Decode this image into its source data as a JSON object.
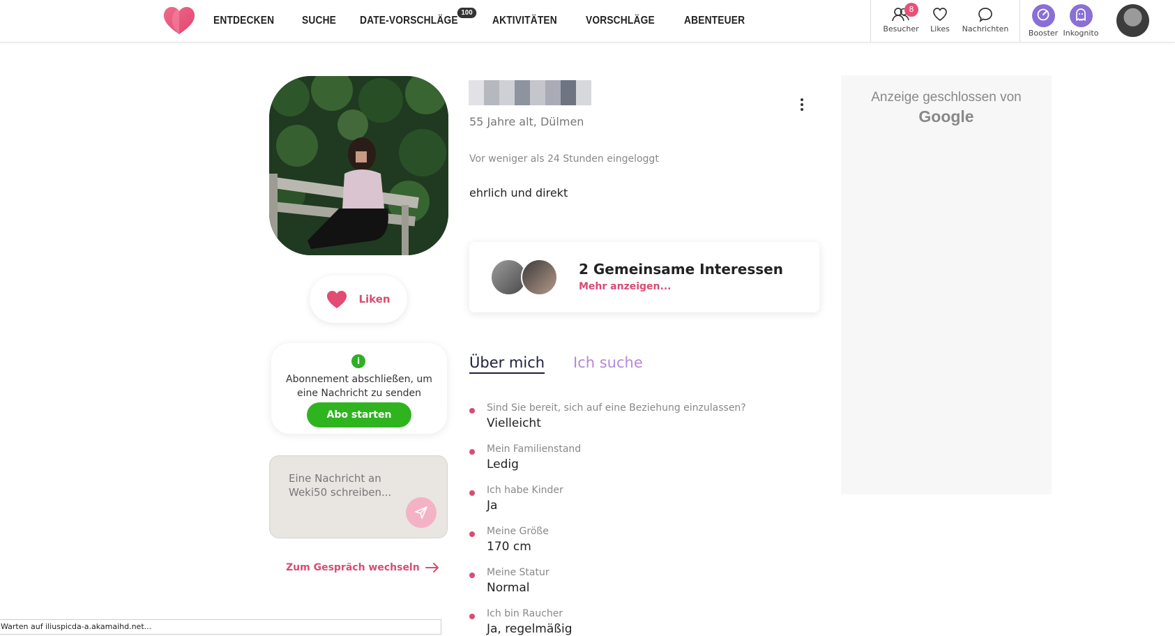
{
  "nav": {
    "items": [
      {
        "label": "ENTDECKEN"
      },
      {
        "label": "SUCHE"
      },
      {
        "label": "DATE-VORSCHLÄGE",
        "badge": "100"
      },
      {
        "label": "AKTIVITÄTEN"
      },
      {
        "label": "VORSCHLÄGE"
      },
      {
        "label": "ABENTEUER"
      }
    ]
  },
  "header_actions": {
    "visitors": {
      "label": "Besucher",
      "badge": "8",
      "icon": "visitors-icon"
    },
    "likes": {
      "label": "Likes",
      "icon": "heart-outline-icon"
    },
    "messages": {
      "label": "Nachrichten",
      "icon": "chat-bubble-icon"
    },
    "booster": {
      "label": "Booster",
      "icon": "booster-icon"
    },
    "incognito": {
      "label": "Inkognito",
      "icon": "ghost-icon"
    }
  },
  "profile": {
    "age_city": "55 Jahre alt, Dülmen",
    "last_login": "Vor weniger als 24 Stunden eingeloggt",
    "bio": "ehrlich und direkt"
  },
  "like_button": {
    "label": "Liken"
  },
  "subscription": {
    "info_glyph": "i",
    "text": "Abonnement abschließen, um eine Nachricht zu senden",
    "button": "Abo starten"
  },
  "message": {
    "placeholder": "Eine Nachricht an Weki50 schreiben..."
  },
  "switch_chat": {
    "label": "Zum Gespräch wechseln"
  },
  "interests": {
    "title": "2 Gemeinsame Interessen",
    "more": "Mehr anzeigen..."
  },
  "tabs": {
    "about": "Über mich",
    "looking": "Ich suche"
  },
  "about": [
    {
      "q": "Sind Sie bereit, sich auf eine Beziehung einzulassen?",
      "a": "Vielleicht"
    },
    {
      "q": "Mein Familienstand",
      "a": "Ledig"
    },
    {
      "q": "Ich habe Kinder",
      "a": "Ja"
    },
    {
      "q": "Meine Größe",
      "a": "170 cm"
    },
    {
      "q": "Meine Statur",
      "a": "Normal"
    },
    {
      "q": "Ich bin Raucher",
      "a": "Ja, regelmäßig"
    }
  ],
  "ad": {
    "text": "Anzeige geschlossen von",
    "brand": "Google"
  },
  "status_bar": "Warten auf iliuspicda-a.akamaihd.net...",
  "colors": {
    "accent": "#d94c74",
    "green": "#2fb41f",
    "purple": "#8a6fd6",
    "tab_inactive": "#b487dc"
  }
}
